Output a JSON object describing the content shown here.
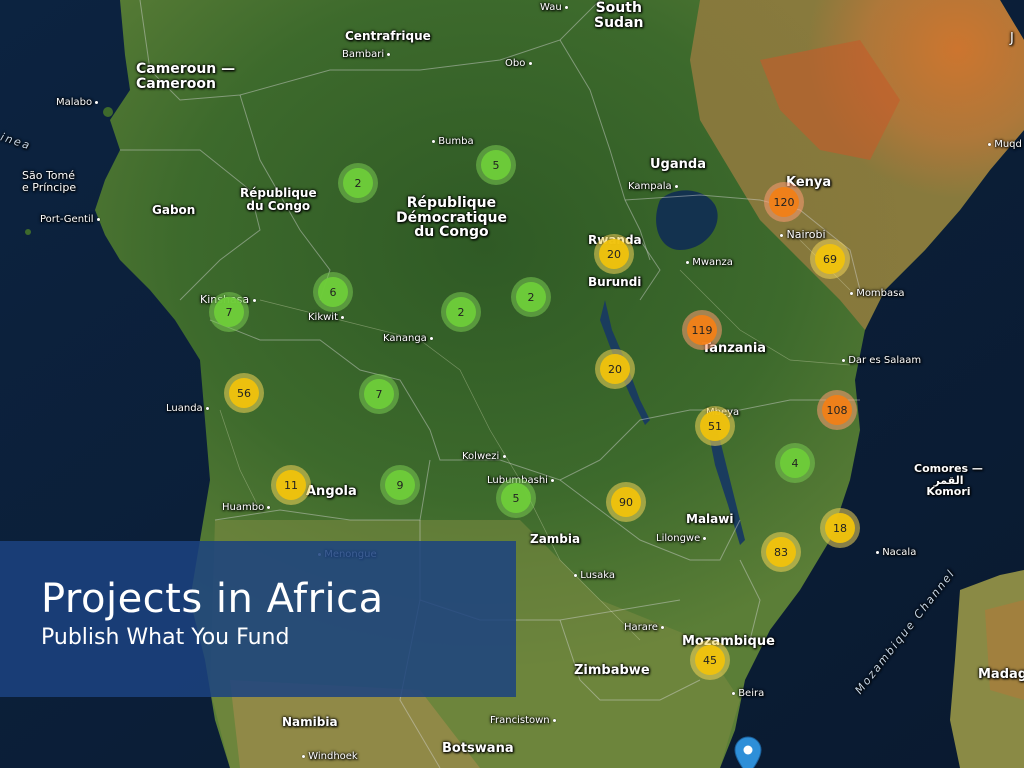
{
  "title": "Projects in Africa",
  "subtitle": "Publish What You Fund",
  "cluster_colors": {
    "small": "#6ecc39",
    "medium": "#f0c20c",
    "large": "#f18017"
  },
  "labels": {
    "wau": "Wau",
    "south_sudan": "South\nSudan",
    "centrafrique": "Centrafrique",
    "bambari": "Bambari",
    "obo": "Obo",
    "cameroun": "Cameroun —\nCameroon",
    "malabo": "Malabo",
    "guinea": "inea",
    "sao_tome": "São Tomé\ne Príncipe",
    "port_gentil": "Port-Gentil",
    "gabon": "Gabon",
    "republique_congo": "République\ndu Congo",
    "bumba": "Bumba",
    "rdc": "République\nDémocratique\ndu Congo",
    "uganda": "Uganda",
    "kampala": "Kampala",
    "kenya": "Kenya",
    "nairobi": "Nairobi",
    "rwanda": "Rwanda",
    "mwanza": "Mwanza",
    "burundi": "Burundi",
    "mombasa": "Mombasa",
    "kinshasa": "Kinshasa",
    "kikwit": "Kikwit",
    "kananga": "Kananga",
    "tanzania": "Tanzania",
    "dar_es_salaam": "Dar es Salaam",
    "luanda": "Luanda",
    "mbeya": "Mbeya",
    "kolwezi": "Kolwezi",
    "lubumbashi": "Lubumbashi",
    "comoros": "Comores —\nالقمر\nKomori",
    "angola": "Angola",
    "huambo": "Huambo",
    "zambia": "Zambia",
    "malawi": "Malawi",
    "lilongwe": "Lilongwe",
    "nacala": "Nacala",
    "menongue": "Menongue",
    "lusaka": "Lusaka",
    "mozambique_channel": "Mozambique Channel",
    "harare": "Harare",
    "mozambique": "Mozambique",
    "zimbabwe": "Zimbabwe",
    "beira": "Beira",
    "madagascar": "Madag",
    "namibia": "Namibia",
    "francistown": "Francistown",
    "botswana": "Botswana",
    "windhoek": "Windhoek",
    "mogadishu": "Muqd",
    "juba_edge": "J"
  },
  "clusters": [
    {
      "id": "c1",
      "count": "5",
      "size": "small"
    },
    {
      "id": "c2",
      "count": "2",
      "size": "small"
    },
    {
      "id": "c3",
      "count": "120",
      "size": "large"
    },
    {
      "id": "c4",
      "count": "20",
      "size": "medium"
    },
    {
      "id": "c5",
      "count": "69",
      "size": "medium"
    },
    {
      "id": "c6",
      "count": "6",
      "size": "small"
    },
    {
      "id": "c7",
      "count": "7",
      "size": "small"
    },
    {
      "id": "c8",
      "count": "2",
      "size": "small"
    },
    {
      "id": "c9",
      "count": "2",
      "size": "small"
    },
    {
      "id": "c10",
      "count": "119",
      "size": "large"
    },
    {
      "id": "c11",
      "count": "20",
      "size": "medium"
    },
    {
      "id": "c12",
      "count": "56",
      "size": "medium"
    },
    {
      "id": "c13",
      "count": "7",
      "size": "small"
    },
    {
      "id": "c14",
      "count": "108",
      "size": "large"
    },
    {
      "id": "c15",
      "count": "51",
      "size": "medium"
    },
    {
      "id": "c16",
      "count": "4",
      "size": "small"
    },
    {
      "id": "c17",
      "count": "11",
      "size": "medium"
    },
    {
      "id": "c18",
      "count": "9",
      "size": "small"
    },
    {
      "id": "c19",
      "count": "5",
      "size": "small"
    },
    {
      "id": "c20",
      "count": "90",
      "size": "medium"
    },
    {
      "id": "c21",
      "count": "18",
      "size": "medium"
    },
    {
      "id": "c22",
      "count": "83",
      "size": "medium"
    },
    {
      "id": "c23",
      "count": "45",
      "size": "medium"
    }
  ]
}
